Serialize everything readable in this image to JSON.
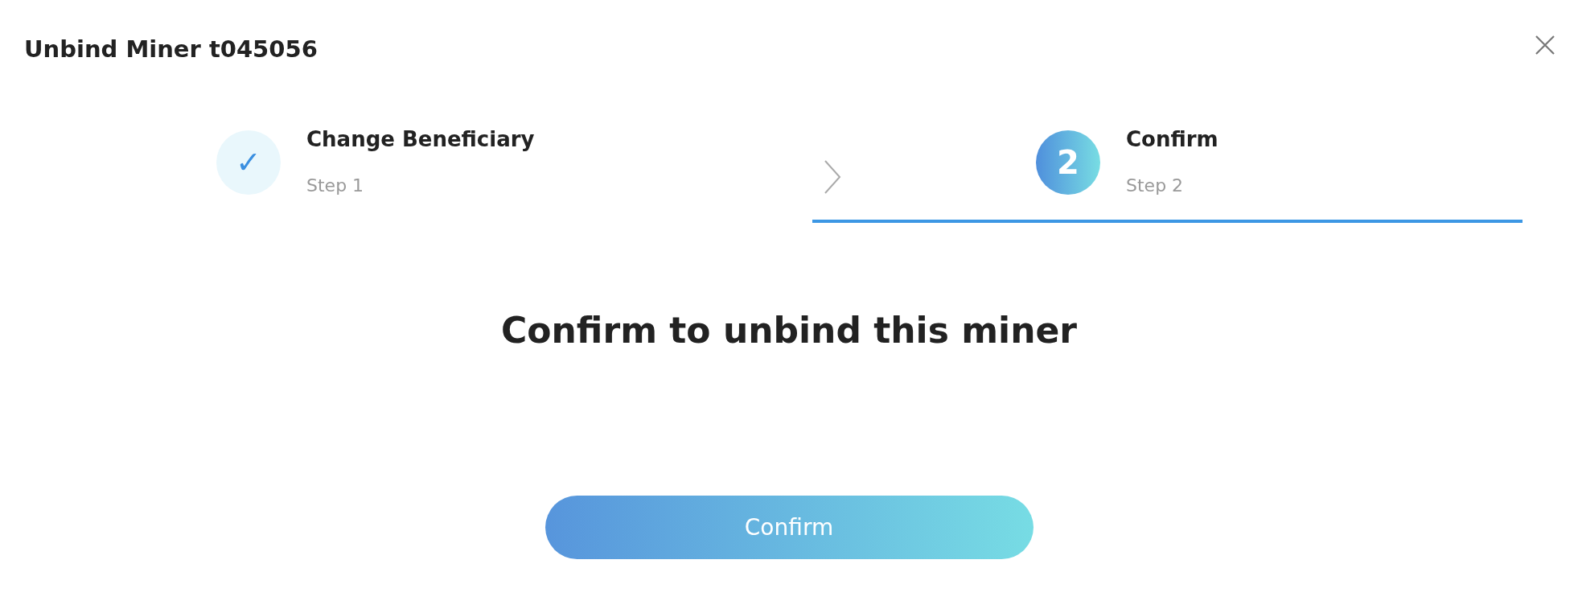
{
  "dialog": {
    "title": "Unbind Miner t045056"
  },
  "steps": [
    {
      "marker": "✓",
      "label": "Change Beneficiary",
      "sublabel": "Step 1",
      "kind": "done",
      "selected": false
    },
    {
      "marker": "2",
      "label": "Confirm",
      "sublabel": "Step 2",
      "kind": "active",
      "selected": true
    }
  ],
  "message": "Confirm to unbind this miner",
  "button": {
    "label": "Confirm"
  }
}
